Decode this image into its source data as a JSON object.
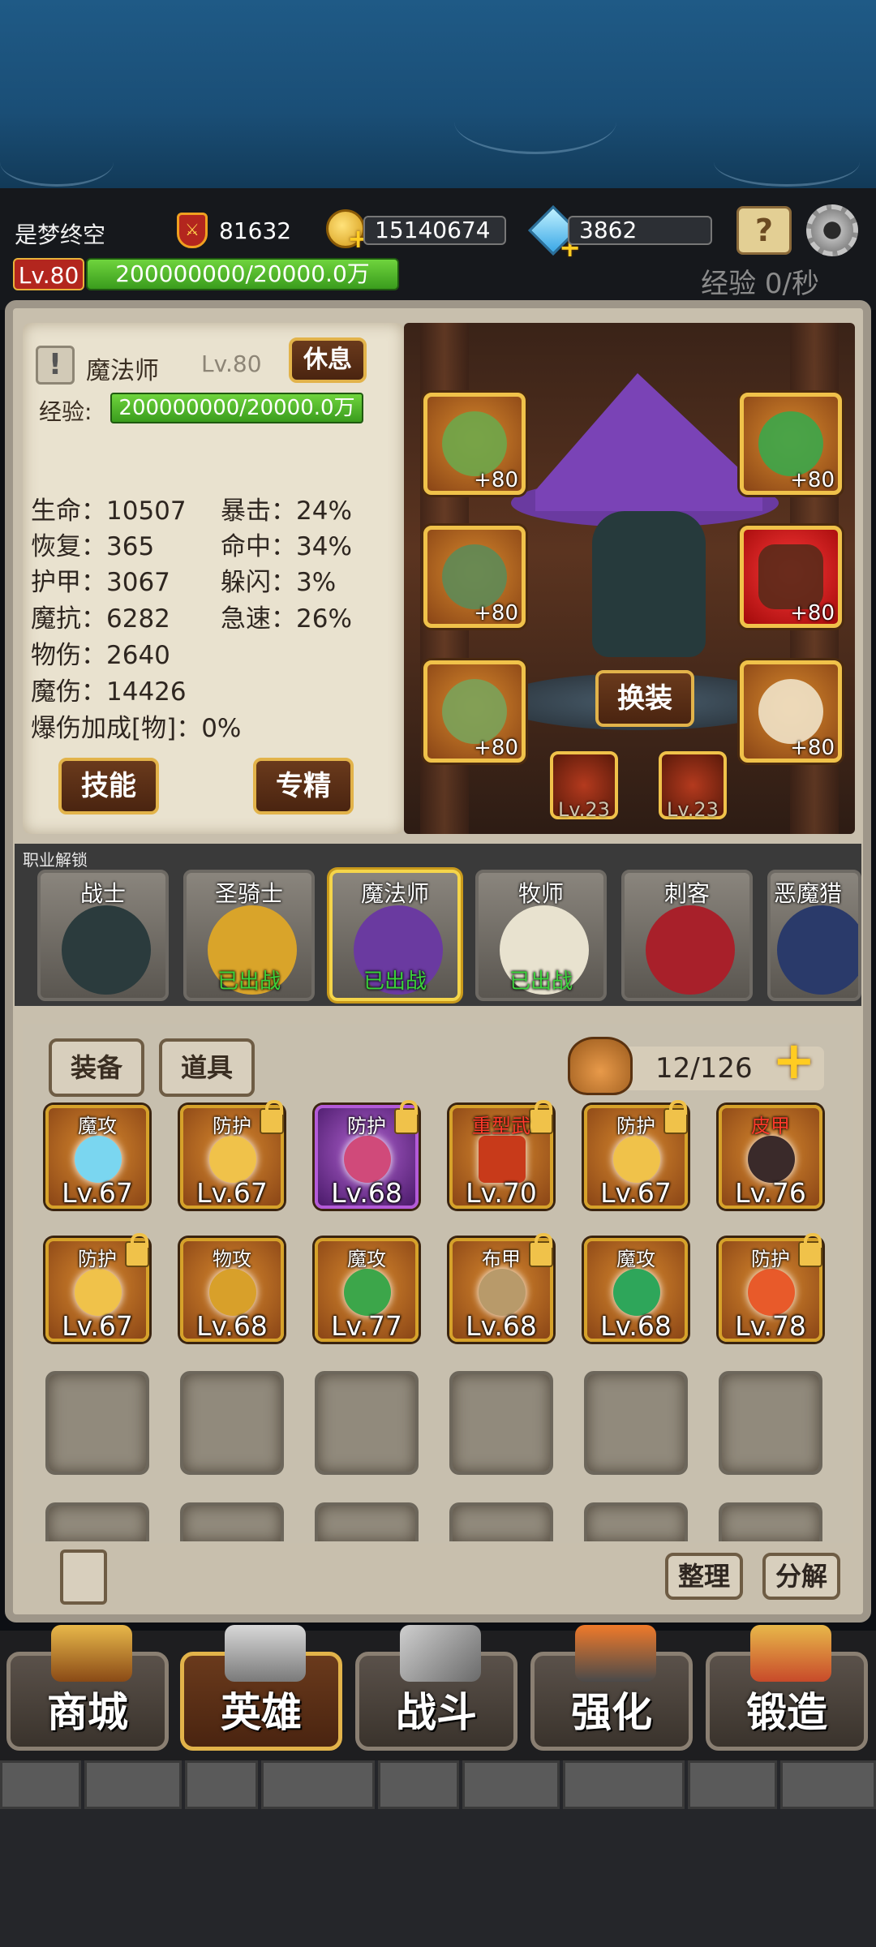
{
  "player": {
    "name": "是梦终空",
    "power": "81632",
    "gold": "15140674",
    "diamonds": "3862",
    "level": "Lv.80",
    "exp": "200000000/20000.0万",
    "exp_rate": "经验 0/秒"
  },
  "hero": {
    "class_name": "魔法师",
    "level": "Lv.80",
    "rest_label": "休息",
    "exp_label": "经验:",
    "exp_value": "200000000/20000.0万",
    "stats_left": [
      {
        "label": "生命：10507"
      },
      {
        "label": "恢复：365"
      },
      {
        "label": "护甲：3067"
      },
      {
        "label": "魔抗：6282"
      },
      {
        "label": "物伤：2640"
      },
      {
        "label": "魔伤：14426"
      },
      {
        "label": "爆伤加成[物]：0%"
      }
    ],
    "stats_right": [
      {
        "label": "暴击：24%"
      },
      {
        "label": "命中：34%"
      },
      {
        "label": "躲闪：3%"
      },
      {
        "label": "急速：26%"
      }
    ],
    "skill_button": "技能",
    "specialty_button": "专精",
    "change_outfit_button": "换装"
  },
  "equipment_slots": [
    {
      "name": "hat",
      "level": "+80"
    },
    {
      "name": "amulet",
      "level": "+80"
    },
    {
      "name": "armor",
      "level": "+80"
    },
    {
      "name": "staff",
      "level": "+80"
    },
    {
      "name": "boots",
      "level": "+80"
    },
    {
      "name": "ring",
      "level": "+80"
    }
  ],
  "gem_slots": [
    {
      "level": "Lv.23"
    },
    {
      "level": "Lv.23"
    }
  ],
  "class_strip": {
    "title": "职业解锁",
    "classes": [
      {
        "name": "战士",
        "status": ""
      },
      {
        "name": "圣骑士",
        "status": "已出战"
      },
      {
        "name": "魔法师",
        "status": "已出战"
      },
      {
        "name": "牧师",
        "status": "已出战"
      },
      {
        "name": "刺客",
        "status": ""
      },
      {
        "name": "恶魔猎",
        "status": ""
      }
    ]
  },
  "inventory": {
    "tab_equipment": "装备",
    "tab_items": "道具",
    "capacity": "12/126",
    "items": [
      {
        "tag": "魔攻",
        "level": "Lv.67",
        "locked": false
      },
      {
        "tag": "防护",
        "level": "Lv.67",
        "locked": true
      },
      {
        "tag": "防护",
        "level": "Lv.68",
        "locked": true
      },
      {
        "tag": "重型武",
        "level": "Lv.70",
        "locked": true
      },
      {
        "tag": "防护",
        "level": "Lv.67",
        "locked": true
      },
      {
        "tag": "皮甲",
        "level": "Lv.76",
        "locked": false
      },
      {
        "tag": "防护",
        "level": "Lv.67",
        "locked": true
      },
      {
        "tag": "物攻",
        "level": "Lv.68",
        "locked": false
      },
      {
        "tag": "魔攻",
        "level": "Lv.77",
        "locked": false
      },
      {
        "tag": "布甲",
        "level": "Lv.68",
        "locked": true
      },
      {
        "tag": "魔攻",
        "level": "Lv.68",
        "locked": false
      },
      {
        "tag": "防护",
        "level": "Lv.78",
        "locked": true
      }
    ],
    "sort_button": "整理",
    "decompose_button": "分解"
  },
  "nav": [
    {
      "label": "商城"
    },
    {
      "label": "英雄"
    },
    {
      "label": "战斗"
    },
    {
      "label": "强化"
    },
    {
      "label": "锻造"
    }
  ]
}
